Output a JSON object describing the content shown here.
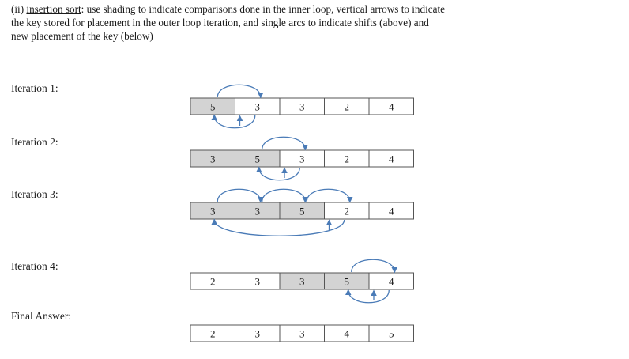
{
  "intro": {
    "lead": "(ii) ",
    "term": "insertion sort",
    "line1_rest": ": use shading to indicate comparisons done in the inner loop, vertical arrows to indicate",
    "line2": "the key stored for placement in the outer loop iteration, and single arcs to indicate shifts (above) and",
    "line3": "new placement of the key (below)"
  },
  "colors": {
    "shaded": "#d3d3d3",
    "arrow": "#4a7bb7",
    "border": "#555555"
  },
  "rows": [
    {
      "label": "Iteration 1:",
      "cells": [
        "5",
        "3",
        "3",
        "2",
        "4"
      ],
      "shaded": [
        true,
        false,
        false,
        false,
        false
      ],
      "key_index": 1,
      "shift_arcs": [
        [
          0,
          1
        ]
      ],
      "placement_arc": [
        1,
        0
      ]
    },
    {
      "label": "Iteration 2:",
      "cells": [
        "3",
        "5",
        "3",
        "2",
        "4"
      ],
      "shaded": [
        true,
        true,
        false,
        false,
        false
      ],
      "key_index": 2,
      "shift_arcs": [
        [
          1,
          2
        ]
      ],
      "placement_arc": [
        2,
        1
      ]
    },
    {
      "label": "Iteration 3:",
      "cells": [
        "3",
        "3",
        "5",
        "2",
        "4"
      ],
      "shaded": [
        true,
        true,
        true,
        false,
        false
      ],
      "key_index": 3,
      "shift_arcs": [
        [
          0,
          1
        ],
        [
          1,
          2
        ],
        [
          2,
          3
        ]
      ],
      "placement_arc": [
        3,
        0
      ]
    },
    {
      "label": "Iteration 4:",
      "cells": [
        "2",
        "3",
        "3",
        "5",
        "4"
      ],
      "shaded": [
        false,
        false,
        true,
        true,
        false
      ],
      "key_index": 4,
      "shift_arcs": [
        [
          3,
          4
        ]
      ],
      "placement_arc": [
        4,
        3
      ]
    },
    {
      "label": "Final Answer:",
      "cells": [
        "2",
        "3",
        "3",
        "4",
        "5"
      ],
      "shaded": [
        false,
        false,
        false,
        false,
        false
      ],
      "key_index": null,
      "shift_arcs": [],
      "placement_arc": null
    }
  ]
}
